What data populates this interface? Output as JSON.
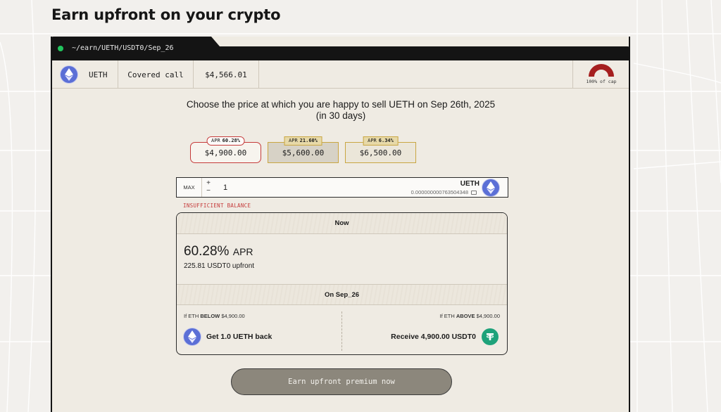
{
  "page": {
    "title": "Earn upfront on your crypto"
  },
  "window": {
    "path": "~/earn/UETH/USDT0/Sep_26",
    "status_color": "#22c55e"
  },
  "infobar": {
    "asset": "UETH",
    "strategy": "Covered call",
    "price": "$4,566.01",
    "cap_label": "100% of cap",
    "cap_fill": 1.0
  },
  "instruction": {
    "line1": "Choose the price at which you are happy to sell UETH on Sep 26th, 2025",
    "line2": "(in 30 days)"
  },
  "strikes": [
    {
      "apr_label": "APR",
      "apr_value": "60.28%",
      "price": "$4,900.00",
      "selected": true
    },
    {
      "apr_label": "APR",
      "apr_value": "21.60%",
      "price": "$5,600.00",
      "selected": false
    },
    {
      "apr_label": "APR",
      "apr_value": "6.34%",
      "price": "$6,500.00",
      "selected": false
    }
  ],
  "amount": {
    "max_label": "MAX",
    "plus": "+",
    "minus": "−",
    "value": "1",
    "asset": "UETH",
    "balance": "0.000000000763504348"
  },
  "error": "INSUFFICIENT BALANCE",
  "summary": {
    "now_header": "Now",
    "apr_value": "60.28%",
    "apr_label": "APR",
    "upfront": "225.81 USDT0 upfront",
    "expiry_header": "On Sep_26",
    "below": {
      "prefix": "If ETH ",
      "keyword": "BELOW",
      "price": " $4,900.00",
      "outcome": "Get 1.0 UETH back"
    },
    "above": {
      "prefix": "If ETH ",
      "keyword": "ABOVE",
      "price": " $4,900.00",
      "outcome": "Receive 4,900.00 USDT0"
    }
  },
  "cta": {
    "label": "Earn upfront premium now"
  },
  "colors": {
    "accent_red": "#c53a3a",
    "gold": "#c9a642",
    "eth": "#5b6fd6",
    "usdt": "#1ea27a",
    "cta_bg": "#8c877c"
  },
  "icons": [
    "ethereum-icon",
    "usdt-icon",
    "wallet-icon",
    "cap-gauge-icon"
  ]
}
